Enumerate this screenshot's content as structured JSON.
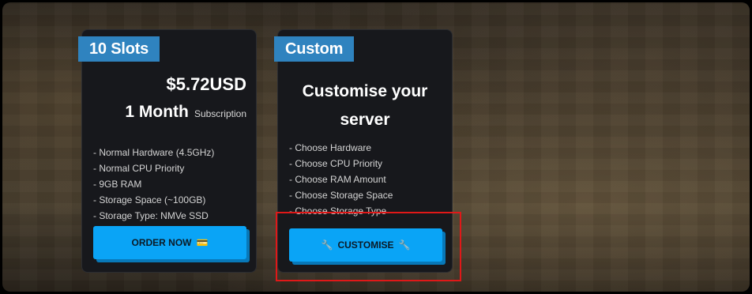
{
  "cards": [
    {
      "ribbon": "10 Slots",
      "price": "$5.72USD",
      "duration_big": "1 Month",
      "duration_small": "Subscription",
      "features": [
        "- Normal Hardware (4.5GHz)",
        "- Normal CPU Priority",
        "- 9GB RAM",
        "- Storage Space (~100GB)",
        "- Storage Type: NMVe SSD"
      ],
      "button_label": "ORDER NOW",
      "button_icon": "💳"
    },
    {
      "ribbon": "Custom",
      "title_line1": "Customise your",
      "title_line2": "server",
      "features": [
        "- Choose Hardware",
        "- Choose CPU Priority",
        "- Choose RAM Amount",
        "- Choose Storage Space",
        "- Choose Storage Type"
      ],
      "button_label": "CUSTOMISE",
      "button_icon": "🔧"
    }
  ],
  "colors": {
    "accent": "#0aa4f6",
    "ribbon": "#2f83bf",
    "card_bg": "#17181c",
    "highlight": "#e01818"
  }
}
